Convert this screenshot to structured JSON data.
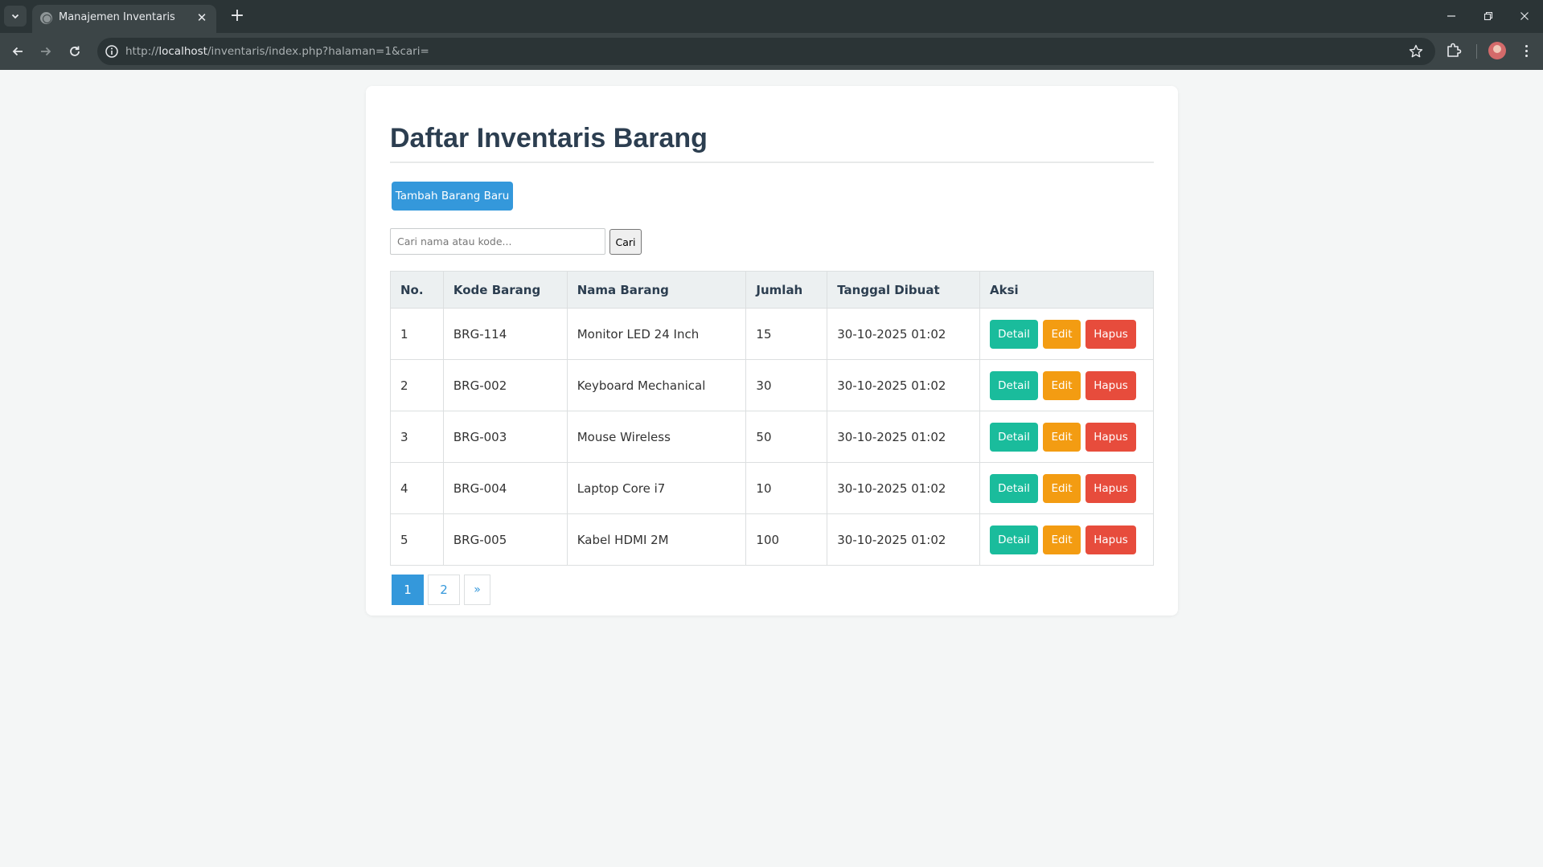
{
  "browser": {
    "tab_title": "Manajemen Inventaris",
    "tab_close": "✕",
    "new_tab": "+",
    "url_prefix": "http://",
    "url_host": "localhost",
    "url_path": "/inventaris/index.php?halaman=1&cari="
  },
  "page": {
    "heading": "Daftar Inventaris Barang",
    "add_button": "Tambah Barang Baru",
    "search": {
      "placeholder": "Cari nama atau kode...",
      "value": "",
      "button": "Cari"
    },
    "table": {
      "headers": [
        "No.",
        "Kode Barang",
        "Nama Barang",
        "Jumlah",
        "Tanggal Dibuat",
        "Aksi"
      ],
      "rows": [
        {
          "no": "1",
          "kode": "BRG-114",
          "nama": "Monitor LED 24 Inch",
          "jumlah": "15",
          "tanggal": "30-10-2025 01:02"
        },
        {
          "no": "2",
          "kode": "BRG-002",
          "nama": "Keyboard Mechanical",
          "jumlah": "30",
          "tanggal": "30-10-2025 01:02"
        },
        {
          "no": "3",
          "kode": "BRG-003",
          "nama": "Mouse Wireless",
          "jumlah": "50",
          "tanggal": "30-10-2025 01:02"
        },
        {
          "no": "4",
          "kode": "BRG-004",
          "nama": "Laptop Core i7",
          "jumlah": "10",
          "tanggal": "30-10-2025 01:02"
        },
        {
          "no": "5",
          "kode": "BRG-005",
          "nama": "Kabel HDMI 2M",
          "jumlah": "100",
          "tanggal": "30-10-2025 01:02"
        }
      ],
      "actions": {
        "detail": "Detail",
        "edit": "Edit",
        "hapus": "Hapus"
      }
    },
    "pagination": {
      "pages": [
        "1",
        "2"
      ],
      "current": "1",
      "next": "»"
    }
  },
  "colors": {
    "primary": "#3498db",
    "detail": "#1abc9c",
    "edit": "#f39c12",
    "hapus": "#e74c3c",
    "heading": "#2c3e50"
  },
  "icons": {
    "tab_search": "chevron-down-icon",
    "back": "arrow-left-icon",
    "forward": "arrow-right-icon",
    "reload": "reload-icon",
    "site_info": "info-icon",
    "bookmark": "star-icon",
    "extensions": "puzzle-icon",
    "profile": "avatar",
    "menu": "kebab-menu-icon",
    "minimize": "minimize-icon",
    "restore": "restore-icon",
    "close": "close-icon"
  }
}
